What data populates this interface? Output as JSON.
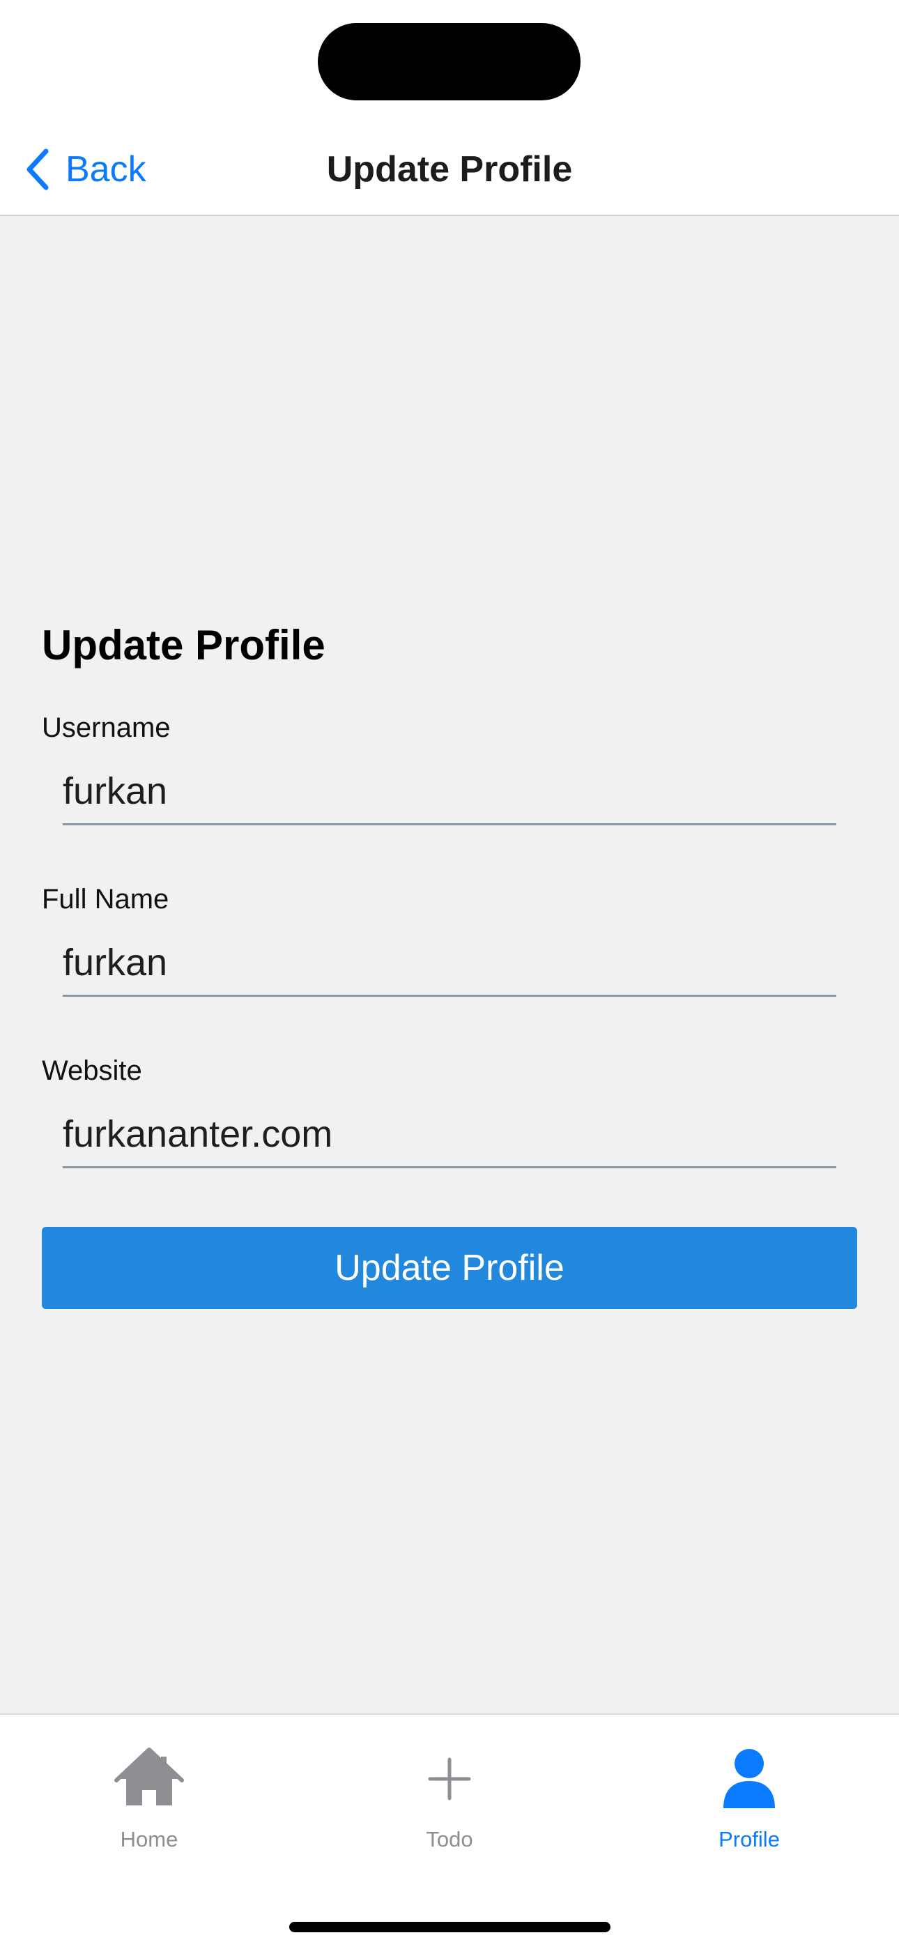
{
  "colors": {
    "accent": "#0a7aff",
    "button_bg": "#2288dd",
    "inactive_tab": "#8e8e93",
    "background": "#f1f1f1"
  },
  "nav": {
    "back_label": "Back",
    "back_icon": "chevron-left-icon",
    "title": "Update Profile"
  },
  "form": {
    "title": "Update Profile",
    "fields": [
      {
        "label": "Username",
        "value": "furkan"
      },
      {
        "label": "Full Name",
        "value": "furkan"
      },
      {
        "label": "Website",
        "value": "furkananter.com"
      }
    ],
    "submit_label": "Update Profile"
  },
  "tabbar": {
    "items": [
      {
        "label": "Home",
        "icon": "home-icon",
        "active": false
      },
      {
        "label": "Todo",
        "icon": "plus-icon",
        "active": false
      },
      {
        "label": "Profile",
        "icon": "person-icon",
        "active": true
      }
    ]
  }
}
